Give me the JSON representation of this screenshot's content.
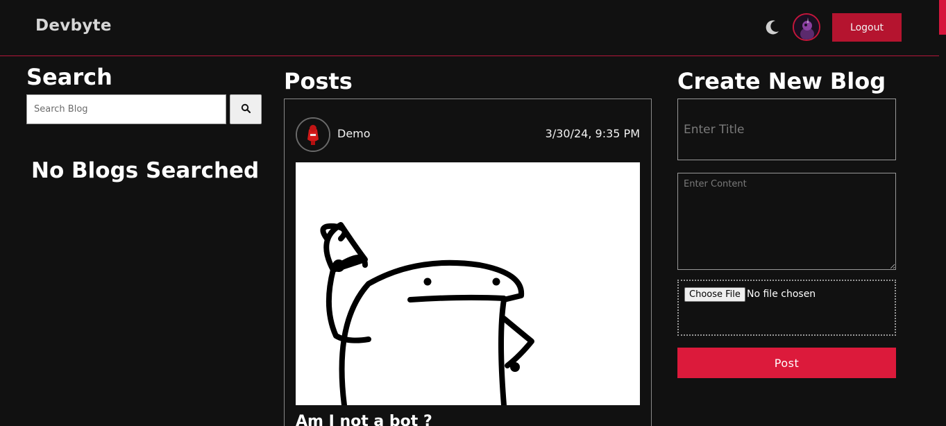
{
  "navbar": {
    "brand": "Devbyte",
    "theme_toggle_icon": "moon-icon",
    "avatar_icon": "user-avatar",
    "logout_label": "Logout",
    "accent_color": "#b5142f"
  },
  "search": {
    "title": "Search",
    "placeholder": "Search Blog",
    "button_icon": "search-icon",
    "empty_message": "No Blogs Searched"
  },
  "posts": {
    "title": "Posts",
    "items": [
      {
        "author": "Demo",
        "date": "3/30/24, 9:35 PM",
        "image": "meme-illustration",
        "title": "Am I not a bot ?"
      }
    ]
  },
  "create": {
    "title": "Create New Blog",
    "title_placeholder": "Enter Title",
    "content_placeholder": "Enter Content",
    "file_button": "Choose File",
    "file_status": "No file chosen",
    "post_label": "Post",
    "button_color": "#dc1a3b"
  }
}
